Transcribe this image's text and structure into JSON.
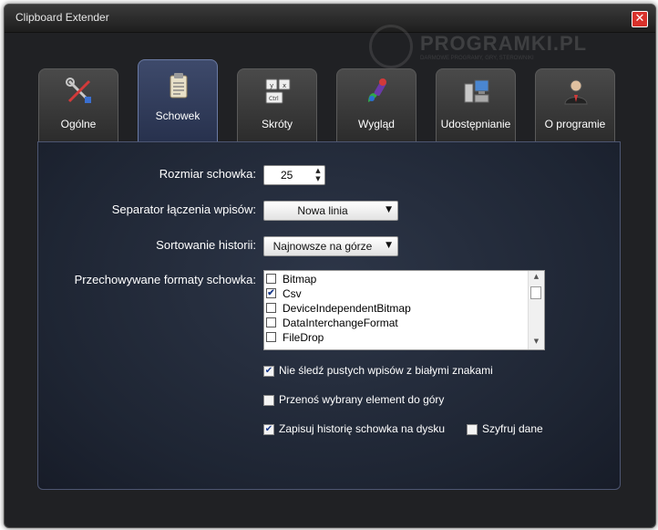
{
  "window": {
    "title": "Clipboard Extender",
    "close_glyph": "✕"
  },
  "watermark": {
    "text": "PROGRAMKI.PL",
    "sub": "DARMOWE PROGRAMY, GRY, STEROWNIKI"
  },
  "tabs": [
    {
      "label": "Ogólne",
      "icon": "tools-icon",
      "active": false
    },
    {
      "label": "Schowek",
      "icon": "clipboard-icon",
      "active": true
    },
    {
      "label": "Skróty",
      "icon": "keyboard-icon",
      "active": false
    },
    {
      "label": "Wygląd",
      "icon": "paint-icon",
      "active": false
    },
    {
      "label": "Udostępnianie",
      "icon": "network-icon",
      "active": false
    },
    {
      "label": "O programie",
      "icon": "user-icon",
      "active": false
    }
  ],
  "settings": {
    "clipboard_size": {
      "label": "Rozmiar schowka:",
      "value": "25"
    },
    "separator": {
      "label": "Separator łączenia wpisów:",
      "value": "Nowa linia"
    },
    "sorting": {
      "label": "Sortowanie historii:",
      "value": "Najnowsze na górze"
    },
    "formats": {
      "label": "Przechowywane formaty schowka:",
      "items": [
        {
          "name": "Bitmap",
          "checked": false
        },
        {
          "name": "Csv",
          "checked": true
        },
        {
          "name": "DeviceIndependentBitmap",
          "checked": false
        },
        {
          "name": "DataInterchangeFormat",
          "checked": false
        },
        {
          "name": "FileDrop",
          "checked": false
        }
      ]
    },
    "ignore_whitespace": {
      "label": "Nie śledź pustych wpisów z białymi znakami",
      "checked": true
    },
    "move_to_top": {
      "label": "Przenoś wybrany element do góry",
      "checked": false
    },
    "save_history": {
      "label": "Zapisuj historię schowka na dysku",
      "checked": true
    },
    "encrypt": {
      "label": "Szyfruj dane",
      "checked": false
    }
  },
  "glyphs": {
    "check": "✔",
    "arrow_up": "▲",
    "arrow_down": "▼"
  }
}
